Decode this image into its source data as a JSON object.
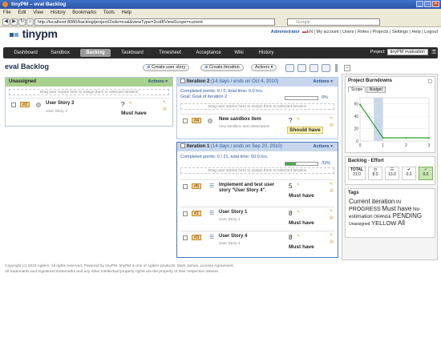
{
  "browser": {
    "window_title": "tinyPM – eval Backlog",
    "menu": [
      "File",
      "Edit",
      "View",
      "History",
      "Bookmarks",
      "Tools",
      "Help"
    ],
    "url": "http://localhost:8080/backlog/project/2xde=eval&viewType=2colBViewScope=current",
    "search_placeholder": "Google"
  },
  "app": {
    "logo_text": "tinypm",
    "user": "Administrator",
    "lang": "EN",
    "links": [
      "My account",
      "Users",
      "Roles",
      "Projects",
      "Settings",
      "Help",
      "Logout"
    ],
    "nav_tabs": [
      "Dashboard",
      "Sandbox",
      "Backlog",
      "Taskboard",
      "Timesheet",
      "Acceptance",
      "Wiki",
      "History"
    ],
    "active_tab": "Backlog",
    "project_label": "Project:",
    "project_value": "tinyPM evaluation"
  },
  "page": {
    "title": "eval Backlog",
    "create_story": "Create user story",
    "create_iteration": "Create iteration",
    "actions": "Actions"
  },
  "unassigned": {
    "title": "Unassigned",
    "actions": "Actions",
    "drop_hint": "Drag user stories here to assign them to selected iteration",
    "stories": [
      {
        "id": "#2",
        "title": "User Story 3",
        "sub": "User Story 3",
        "points": "?",
        "value": "Must have"
      }
    ]
  },
  "iteration2": {
    "title": "Iteration 2",
    "dates": "(14 days / ends on Oct 4, 2010)",
    "actions": "Actions",
    "completed": "Completed points: 0 / 0, total time: 0.0 hrs.",
    "goal": "Goal: Goal of iteration 2",
    "progress_pct": 0,
    "progress_label": "0%",
    "drop_hint": "Drag user stories here to assign them to selected iteration",
    "stories": [
      {
        "id": "#4",
        "title": "New sandbox item",
        "sub": "new sandbox item description",
        "points": "?",
        "value": "Should have"
      }
    ]
  },
  "iteration1": {
    "title": "Iteration 1",
    "dates": "(14 days / ends on Sep 20, 2010)",
    "actions": "Actions",
    "completed": "Completed points: 0 / 21, total time: 50.0 hrs.",
    "progress_pct": 33,
    "progress_label": "33%",
    "drop_hint": "Drag user stories here to assign them to selected iteration",
    "stories": [
      {
        "id": "#5",
        "title": "Implement and test user story \"User Story 4\".",
        "sub": "",
        "points": "5",
        "value": "Must have"
      },
      {
        "id": "#1",
        "title": "User Story 1",
        "sub": "User Story 1",
        "points": "8",
        "value": "Must have"
      },
      {
        "id": "#3",
        "title": "User Story 4",
        "sub": "User Story 4",
        "points": "8",
        "value": "Must have"
      }
    ]
  },
  "burndown": {
    "title": "Project Burndowns",
    "tabs": [
      "Scope",
      "Budget"
    ],
    "y_ticks": [
      "60",
      "40",
      "20",
      "0"
    ],
    "x_ticks": [
      "0",
      "1",
      "2",
      "3"
    ]
  },
  "chart_data": {
    "type": "line",
    "x": [
      0,
      1,
      2,
      3
    ],
    "series": [
      {
        "values": [
          59,
          5,
          5,
          5
        ]
      }
    ],
    "ylim": [
      0,
      70
    ],
    "xlim": [
      0,
      3
    ]
  },
  "effort": {
    "title": "Backlog - Effort",
    "boxes": [
      {
        "label": "TOTAL",
        "value": "21.0"
      },
      {
        "label": "",
        "value": "8.0"
      },
      {
        "label": "",
        "value": "13.0"
      },
      {
        "label": "",
        "value": "0.0"
      },
      {
        "label": "",
        "value": "0.0"
      }
    ]
  },
  "tags": {
    "title": "Tags",
    "items": [
      {
        "text": "Current iteration",
        "size": 8
      },
      {
        "text": "IN",
        "size": 6
      },
      {
        "text": "PROGRESS",
        "size": 7
      },
      {
        "text": "Must have",
        "size": 8
      },
      {
        "text": "No estimation",
        "size": 6.5
      },
      {
        "text": "ORANGE",
        "size": 5
      },
      {
        "text": "PENDING",
        "size": 8
      },
      {
        "text": "Unassigned",
        "size": 5
      },
      {
        "text": "YELLOW",
        "size": 7.5
      },
      {
        "text": "All",
        "size": 8
      }
    ]
  },
  "footer": {
    "line1": "Copyright (c) 2010 Agilers. All rights reserved. Powered by tinyPM. tinyPM is one of Agilers products. Mark James. License Agreement",
    "line2": "All trademarks and registered trademarks and any other intellectual property rights are the property of their respective owners."
  },
  "colors": {
    "accent": "#2c5aa0",
    "nav_bg": "#2b2b2b",
    "unassigned_header": "#a9d18e",
    "iteration_header": "#c6d6ec",
    "story_id_bg": "#f9d28e"
  }
}
